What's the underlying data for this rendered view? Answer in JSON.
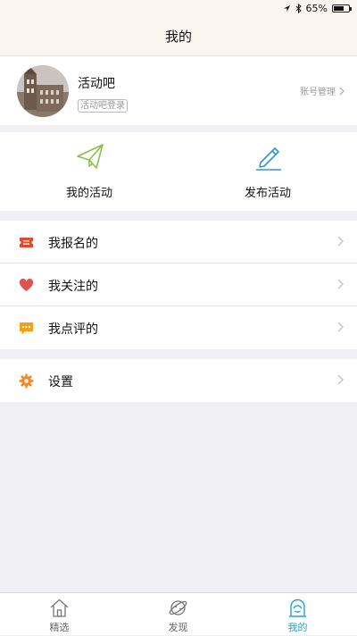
{
  "status_bar": {
    "battery": "65%"
  },
  "header": {
    "title": "我的"
  },
  "profile": {
    "name": "活动吧",
    "login_tag": "活动吧登录",
    "account_link": "账号管理"
  },
  "actions": [
    {
      "label": "我的活动",
      "icon": "paper-plane-icon"
    },
    {
      "label": "发布活动",
      "icon": "pencil-icon"
    }
  ],
  "list": [
    {
      "label": "我报名的",
      "icon": "ticket-icon"
    },
    {
      "label": "我关注的",
      "icon": "heart-icon"
    },
    {
      "label": "我点评的",
      "icon": "comment-icon"
    }
  ],
  "settings": {
    "label": "设置",
    "icon": "gear-icon"
  },
  "tabbar": {
    "items": [
      {
        "label": "精选",
        "icon": "home-icon"
      },
      {
        "label": "发现",
        "icon": "planet-icon"
      },
      {
        "label": "我的",
        "icon": "profile-icon"
      }
    ],
    "active_index": 2
  },
  "colors": {
    "accent": "#2a9fd0",
    "plane_green": "#8bbf4a",
    "pencil_blue": "#3a93c8",
    "ticket_red": "#e2492f",
    "heart_red": "#e05252",
    "comment_orange": "#f2a219",
    "gear_orange": "#ee8a2b"
  }
}
